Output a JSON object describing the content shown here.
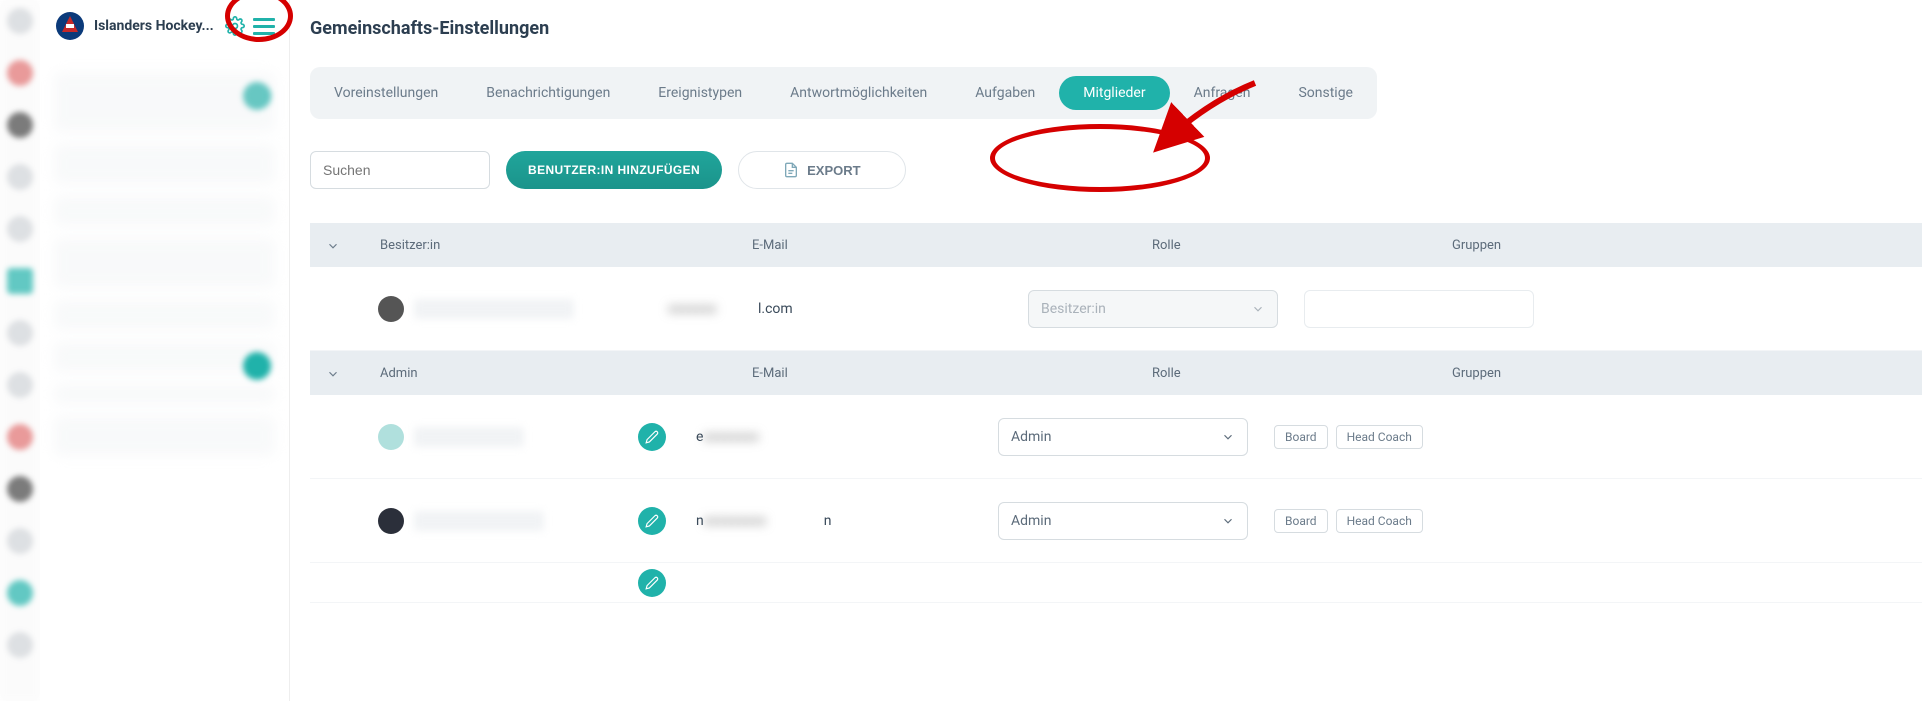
{
  "sidebar": {
    "club_name": "Islanders Hockey..."
  },
  "page": {
    "title": "Gemeinschafts-Einstellungen"
  },
  "tabs": [
    {
      "label": "Voreinstellungen",
      "active": false
    },
    {
      "label": "Benachrichtigungen",
      "active": false
    },
    {
      "label": "Ereignistypen",
      "active": false
    },
    {
      "label": "Antwortmöglichkeiten",
      "active": false
    },
    {
      "label": "Aufgaben",
      "active": false
    },
    {
      "label": "Mitglieder",
      "active": true
    },
    {
      "label": "Anfragen",
      "active": false
    },
    {
      "label": "Sonstige",
      "active": false
    }
  ],
  "controls": {
    "search_placeholder": "Suchen",
    "add_user_label": "BENUTZER:IN HINZUFÜGEN",
    "export_label": "EXPORT"
  },
  "columns": {
    "email": "E-Mail",
    "role": "Rolle",
    "groups": "Gruppen"
  },
  "sections": [
    {
      "title": "Besitzer:in",
      "rows": [
        {
          "email_suffix": "l.com",
          "role": "Besitzer:in",
          "role_disabled": true,
          "groups": [],
          "has_edit": false
        }
      ]
    },
    {
      "title": "Admin",
      "rows": [
        {
          "email_prefix": "e",
          "role": "Admin",
          "role_disabled": false,
          "groups": [
            "Board",
            "Head Coach"
          ],
          "has_edit": true
        },
        {
          "email_prefix": "n",
          "email_suffix": "n",
          "role": "Admin",
          "role_disabled": false,
          "groups": [
            "Board",
            "Head Coach"
          ],
          "has_edit": true
        }
      ]
    }
  ],
  "annotations": {
    "circle_gear": true,
    "circle_export": true,
    "arrow_to_export": true
  }
}
